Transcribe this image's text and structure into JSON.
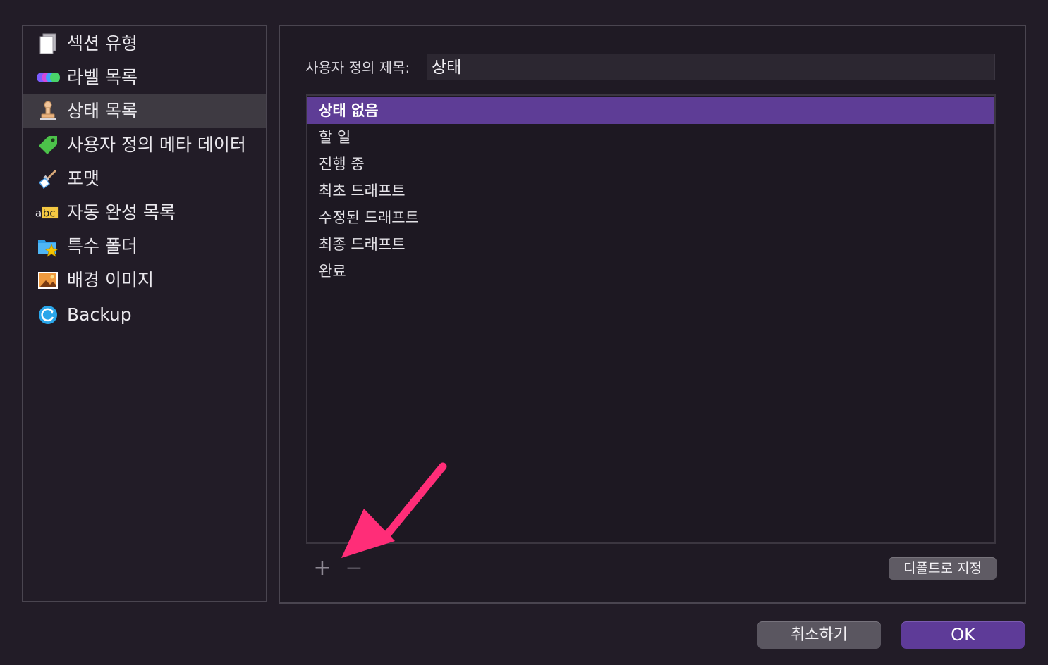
{
  "sidebar": {
    "items": [
      {
        "label": "섹션 유형",
        "icon": "document-icon"
      },
      {
        "label": "라벨 목록",
        "icon": "color-dots-icon"
      },
      {
        "label": "상태 목록",
        "icon": "stamp-icon",
        "selected": true
      },
      {
        "label": "사용자 정의 메타 데이터",
        "icon": "tag-icon"
      },
      {
        "label": "포맷",
        "icon": "brush-icon"
      },
      {
        "label": "자동 완성 목록",
        "icon": "abc-icon"
      },
      {
        "label": "특수 폴더",
        "icon": "folder-star-icon"
      },
      {
        "label": "배경 이미지",
        "icon": "image-icon"
      },
      {
        "label": "Backup",
        "icon": "backup-icon"
      }
    ]
  },
  "main": {
    "title_label": "사용자 정의 제목:",
    "title_value": "상태",
    "statuses": [
      {
        "label": "상태 없음",
        "selected": true
      },
      {
        "label": "할 일"
      },
      {
        "label": "진행 중"
      },
      {
        "label": "최초 드래프트"
      },
      {
        "label": "수정된 드래프트"
      },
      {
        "label": "최종 드래프트"
      },
      {
        "label": "완료"
      }
    ],
    "add_label": "+",
    "remove_label": "−",
    "default_label": "디폴트로 지정"
  },
  "footer": {
    "cancel_label": "취소하기",
    "ok_label": "OK"
  },
  "colors": {
    "background": "#221c27",
    "accent": "#5e3d96",
    "annotation_arrow": "#ff2d78"
  }
}
